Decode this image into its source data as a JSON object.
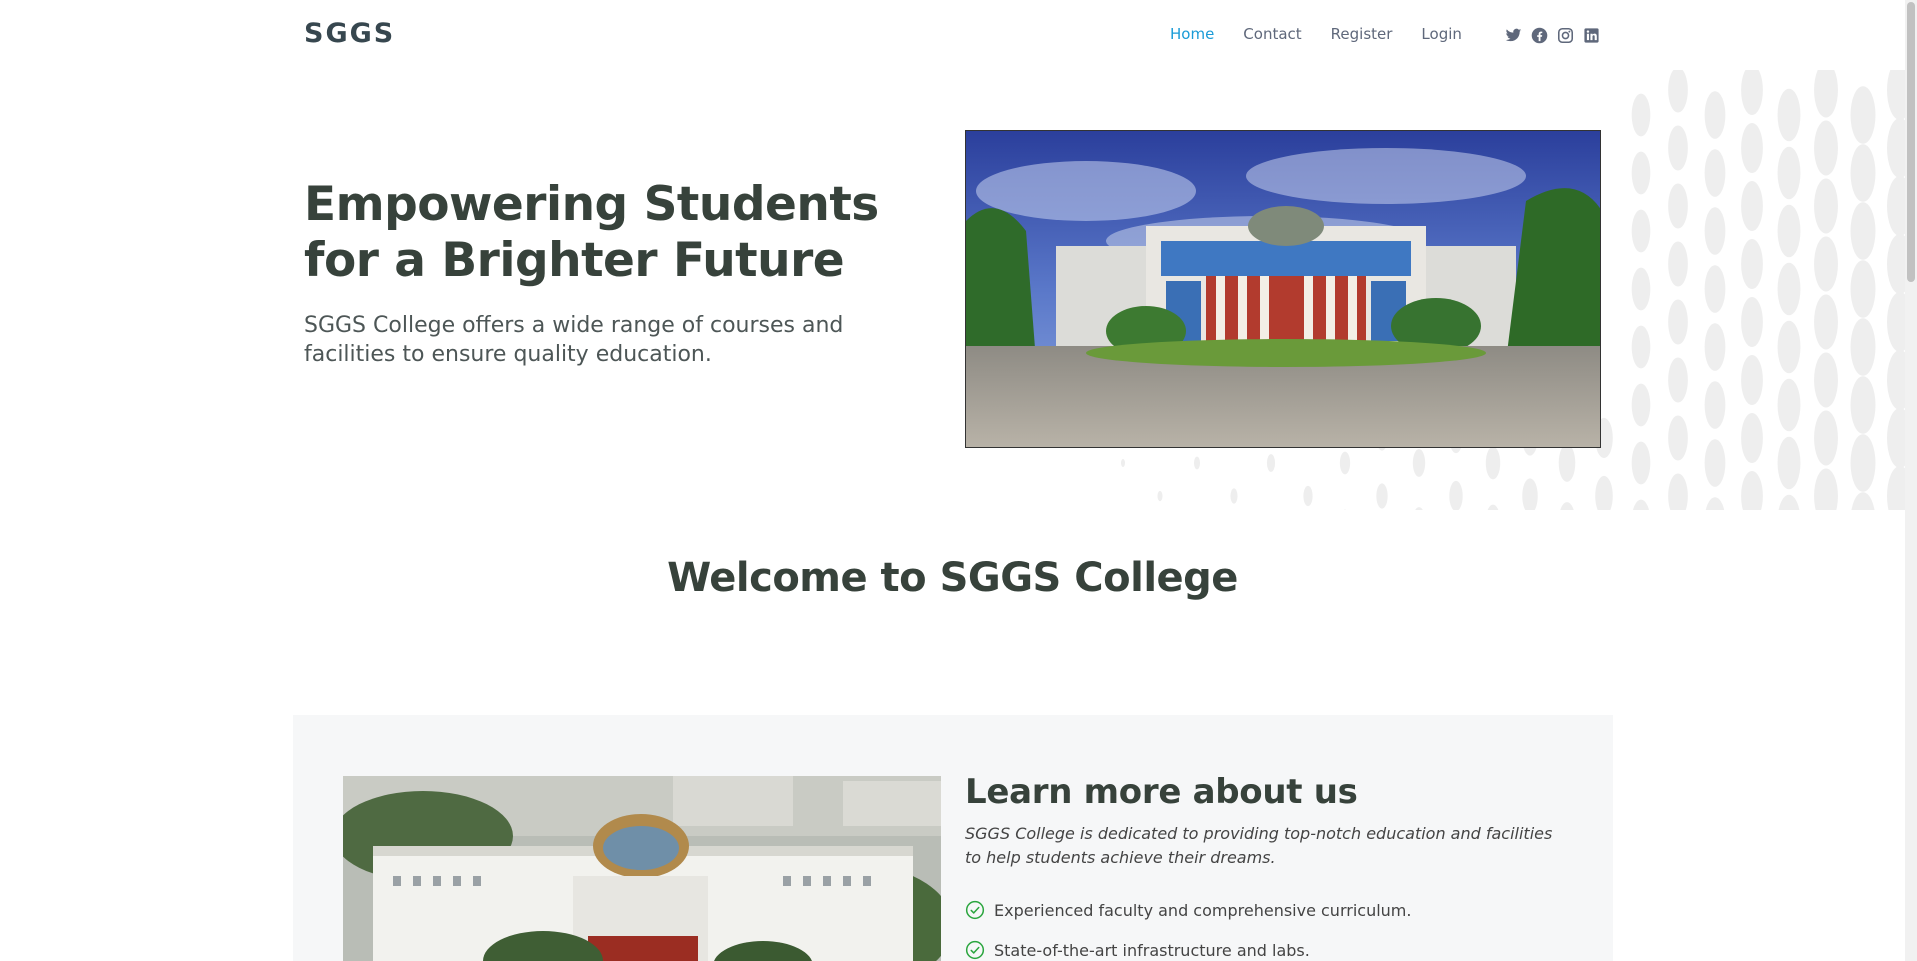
{
  "header": {
    "logo": "SGGS",
    "nav": [
      {
        "label": "Home",
        "active": true
      },
      {
        "label": "Contact",
        "active": false
      },
      {
        "label": "Register",
        "active": false
      },
      {
        "label": "Login",
        "active": false
      }
    ],
    "social": [
      "twitter-icon",
      "facebook-icon",
      "instagram-icon",
      "linkedin-icon"
    ]
  },
  "hero": {
    "title": "Empowering Students for a Brighter Future",
    "subtitle": "SGGS College offers a wide range of courses and facilities to ensure quality education."
  },
  "welcome": {
    "title": "Welcome to SGGS College"
  },
  "about": {
    "title": "Learn more about us",
    "description": "SGGS College is dedicated to providing top-notch education and facilities to help students achieve their dreams.",
    "points": [
      "Experienced faculty and comprehensive curriculum.",
      "State-of-the-art infrastructure and labs."
    ]
  },
  "colors": {
    "accent": "#1a9bd7",
    "check": "#2aa53e",
    "about_bg": "#f6f7f8"
  }
}
